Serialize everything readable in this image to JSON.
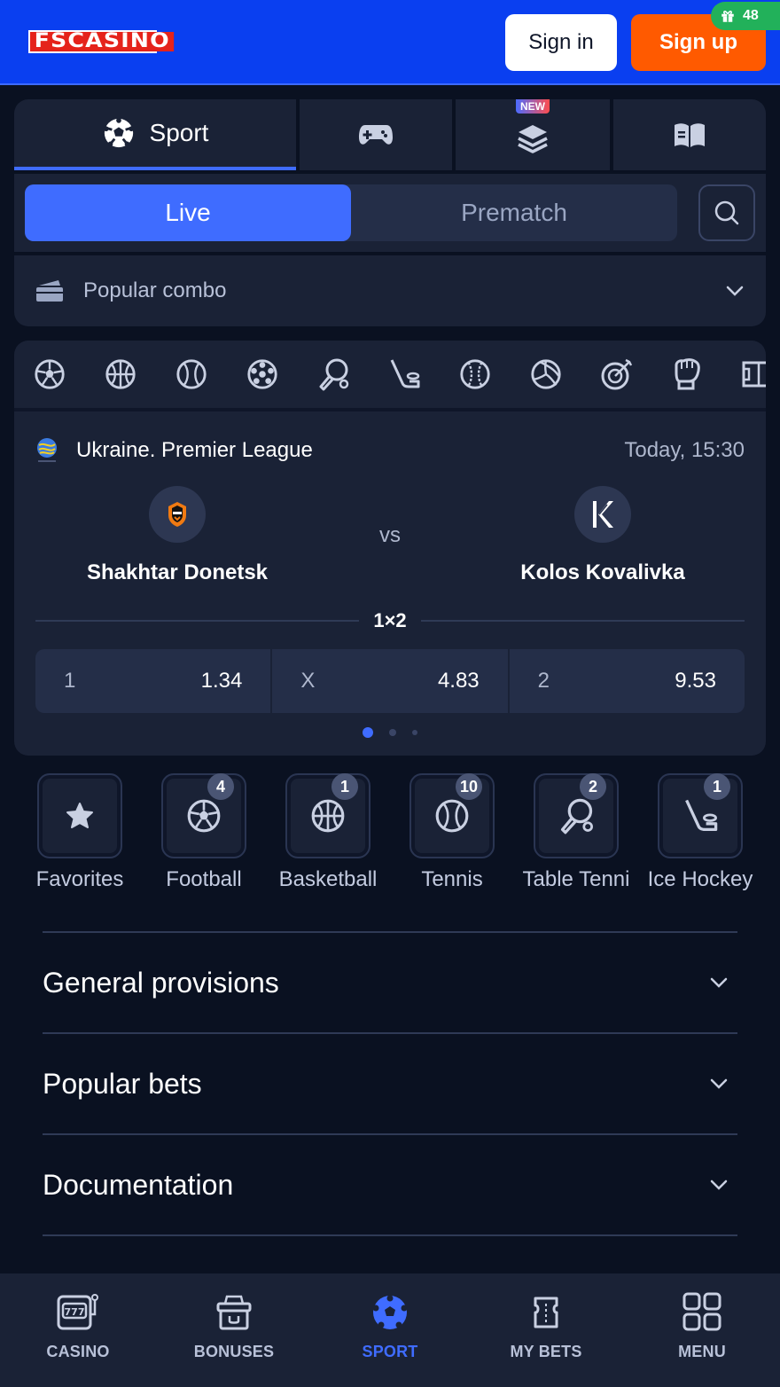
{
  "header": {
    "logo_text": "FSCASINO",
    "signin_label": "Sign in",
    "signup_label": "Sign up",
    "gift_count": "48"
  },
  "tabs": {
    "sport_label": "Sport",
    "new_badge": "NEW",
    "icons": [
      "soccer-ball-icon",
      "gamepad-icon",
      "layers-icon",
      "book-icon"
    ]
  },
  "mode": {
    "live_label": "Live",
    "prematch_label": "Prematch"
  },
  "combo": {
    "label": "Popular combo"
  },
  "sport_filters": [
    "football",
    "basketball",
    "tennis",
    "futsal",
    "table-tennis",
    "ice-hockey",
    "baseball",
    "volleyball",
    "darts",
    "boxing",
    "field"
  ],
  "match": {
    "league": "Ukraine. Premier League",
    "time": "Today, 15:30",
    "home_team": "Shakhtar Donetsk",
    "away_team": "Kolos Kovalivka",
    "vs": "vs",
    "market": "1×2",
    "odds": [
      {
        "label": "1",
        "value": "1.34"
      },
      {
        "label": "X",
        "value": "4.83"
      },
      {
        "label": "2",
        "value": "9.53"
      }
    ]
  },
  "categories": [
    {
      "label": "Favorites",
      "count": ""
    },
    {
      "label": "Football",
      "count": "4"
    },
    {
      "label": "Basketball",
      "count": "1"
    },
    {
      "label": "Tennis",
      "count": "10"
    },
    {
      "label": "Table Tenni",
      "count": "2"
    },
    {
      "label": "Ice Hockey",
      "count": "1"
    }
  ],
  "accordions": [
    "General provisions",
    "Popular bets",
    "Documentation"
  ],
  "bottom_nav": [
    {
      "label": "CASINO",
      "active": false
    },
    {
      "label": "BONUSES",
      "active": false
    },
    {
      "label": "SPORT",
      "active": true
    },
    {
      "label": "MY BETS",
      "active": false
    },
    {
      "label": "MENU",
      "active": false
    }
  ],
  "colors": {
    "header_bg": "#0a3ff0",
    "accent": "#3f6cff",
    "signup": "#ff5a00",
    "page_bg": "#0a1121",
    "card_bg": "#1a2236"
  }
}
